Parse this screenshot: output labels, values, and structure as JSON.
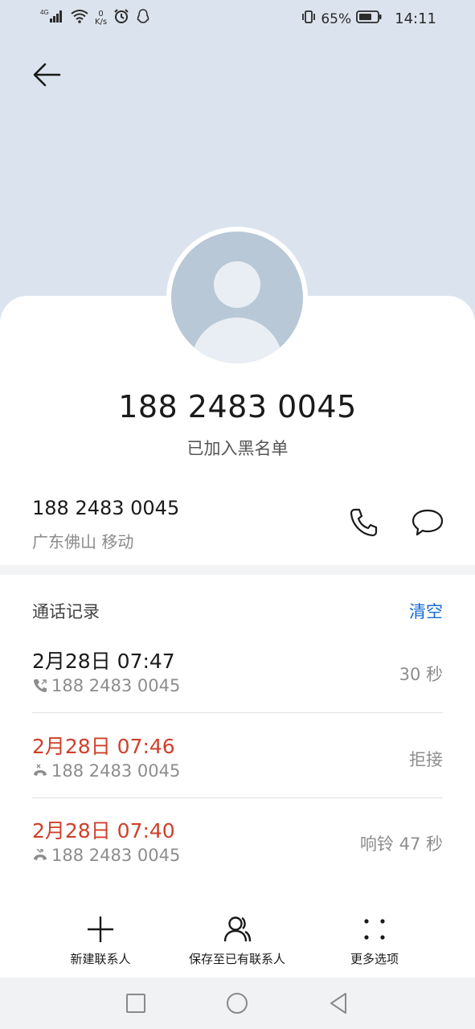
{
  "status_bar": {
    "network": "4G",
    "net_speed_value": "0",
    "net_speed_unit": "K/s",
    "battery": "65%",
    "time": "14:11"
  },
  "contact": {
    "number_display": "188 2483 0045",
    "status": "已加入黑名单",
    "number_row": "188 2483 0045",
    "location": "广东佛山 移动"
  },
  "call_log": {
    "title": "通话记录",
    "clear_label": "清空",
    "entries": [
      {
        "time": "2月28日 07:47",
        "number": "188 2483 0045",
        "detail": "30 秒",
        "type": "outgoing"
      },
      {
        "time": "2月28日 07:46",
        "number": "188 2483 0045",
        "detail": "拒接",
        "type": "rejected"
      },
      {
        "time": "2月28日 07:40",
        "number": "188 2483 0045",
        "detail": "响铃 47 秒",
        "type": "missed"
      }
    ]
  },
  "actions": {
    "new_contact": "新建联系人",
    "save_existing": "保存至已有联系人",
    "more_options": "更多选项"
  },
  "colors": {
    "header_bg": "#dbe4ee",
    "missed_red": "#d0402b",
    "accent_blue": "#1767d3"
  }
}
